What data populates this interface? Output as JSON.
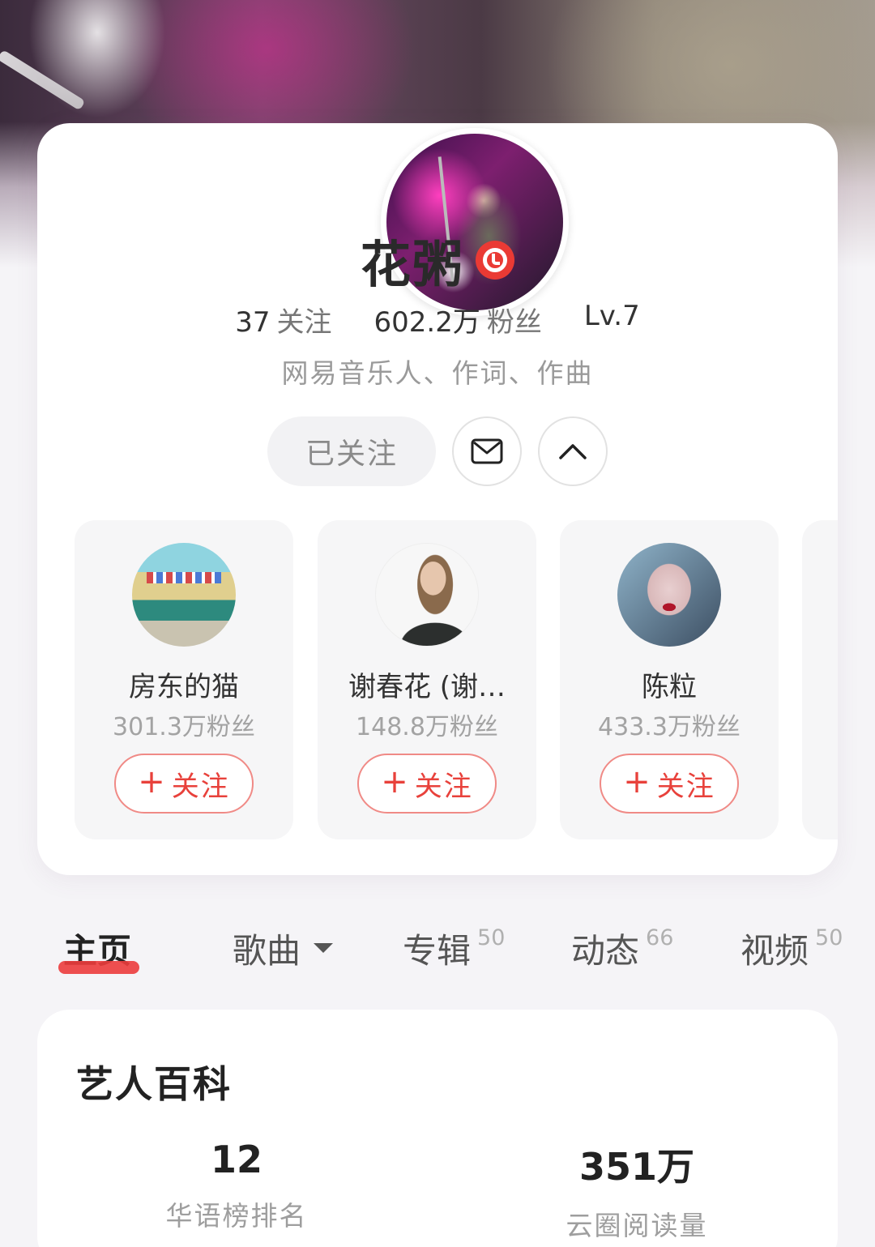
{
  "profile": {
    "name": "花粥",
    "stats": {
      "following_count": "37",
      "following_label": "关注",
      "fans_count": "602.2万",
      "fans_label": "粉丝",
      "level": "Lv.7"
    },
    "bio": "网易音乐人、作词、作曲",
    "followed_label": "已关注",
    "icons": {
      "verify": "verified-musician-icon",
      "message": "mail-icon",
      "collapse": "chevron-up-icon"
    }
  },
  "recommended": [
    {
      "name": "房东的猫",
      "fans": "301.3万粉丝",
      "follow_label": "关注"
    },
    {
      "name": "谢春花 (谢…",
      "fans": "148.8万粉丝",
      "follow_label": "关注"
    },
    {
      "name": "陈粒",
      "fans": "433.3万粉丝",
      "follow_label": "关注"
    }
  ],
  "tabs": [
    {
      "label": "主页",
      "count": ""
    },
    {
      "label": "歌曲",
      "count": ""
    },
    {
      "label": "专辑",
      "count": "50"
    },
    {
      "label": "动态",
      "count": "66"
    },
    {
      "label": "视频",
      "count": "50"
    }
  ],
  "wiki": {
    "title": "艺人百科",
    "stats": [
      {
        "value": "12",
        "label": "华语榜排名"
      },
      {
        "value": "351万",
        "label": "云圈阅读量"
      }
    ]
  },
  "colors": {
    "accent": "#e8413b",
    "tab_underline": "#ec3c3c",
    "page_bg": "#f5f4f7"
  }
}
